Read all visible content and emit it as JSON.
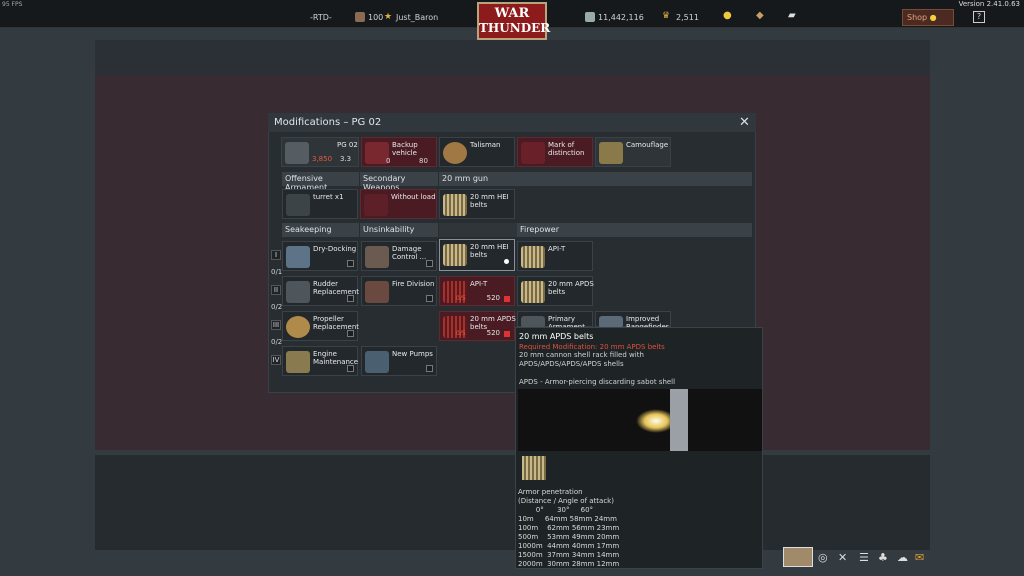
{
  "topbar": {
    "fps": "95 FPS",
    "version": "Version 2.41.0.63",
    "mode": "-RTD-",
    "level": "100",
    "username": "Just_Baron",
    "silver": "11,442,116",
    "gold": "2,511",
    "shop": "Shop",
    "help": "?"
  },
  "logo": {
    "line1": "WAR",
    "line2": "THUNDER"
  },
  "modal": {
    "title": "Modifications – PG 02",
    "top_slots": [
      {
        "label": "PG 02",
        "sub": "3,850",
        "sub2": "3.3"
      },
      {
        "label": "Backup vehicle",
        "sub": "0",
        "sub2": "80"
      },
      {
        "label": "Talisman"
      },
      {
        "label": "Mark of distinction"
      },
      {
        "label": "Camouflage"
      }
    ],
    "cat_headers": [
      "Offensive Armament",
      "Secondary Weapons",
      "20 mm gun"
    ],
    "weapons": [
      "turret x1",
      "Without load",
      "20 mm HEI belts"
    ],
    "sections": [
      "Seakeeping",
      "Unsinkability",
      "Firepower"
    ],
    "ranks": [
      "I",
      "0/1",
      "II",
      "0/2",
      "III",
      "0/2",
      "IV"
    ],
    "seakeeping": [
      "Dry-Docking",
      "Rudder Replacement",
      "Propeller Replacement",
      "Engine Maintenance"
    ],
    "unsinkability": [
      "Damage Control ...",
      "Fire Division",
      "New Pumps"
    ],
    "belts": [
      {
        "label": "20 mm HEI belts"
      },
      {
        "label": "API-T",
        "progress": "0/5",
        "price": "520"
      },
      {
        "label": "20 mm APDS belts",
        "progress": "0/5",
        "price": "520"
      }
    ],
    "firepower": [
      "API-T",
      "20 mm APDS belts",
      "Primary Armament",
      "Improved Rangefinder"
    ]
  },
  "tooltip": {
    "title": "20 mm APDS belts",
    "required": "Required Modification: 20 mm APDS belts",
    "desc": "20 mm cannon shell rack filled with APDS/APDS/APDS/APDS shells",
    "type": "APDS - Armor-piercing discarding sabot shell",
    "pen_title": "Armor penetration",
    "pen_sub": "(Distance / Angle of attack)",
    "angles": "        0°      30°     60°",
    "rows": [
      "10m     64mm 58mm 24mm",
      "100m    62mm 56mm 23mm",
      "500m    53mm 49mm 20mm",
      "1000m  44mm 40mm 17mm",
      "1500m  37mm 34mm 14mm",
      "2000m  30mm 28mm 12mm"
    ]
  }
}
